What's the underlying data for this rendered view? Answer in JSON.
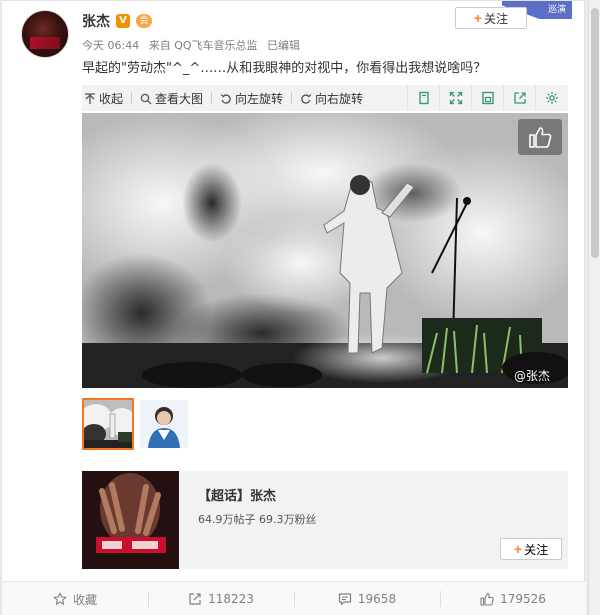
{
  "corner_tag": "巡演",
  "user": {
    "name": "张杰",
    "verified_badge": "V",
    "vip_badge": "会"
  },
  "follow_label": "关注",
  "meta": {
    "time": "今天 06:44",
    "source": "来自 QQ飞车音乐总监",
    "edited": "已编辑"
  },
  "post_text": "早起的\"劳动杰\"^_^……从和我眼神的对视中，你看得出我想说啥吗？",
  "media_toolbar": {
    "collapse": "收起",
    "view_large": "查看大图",
    "rotate_left": "向左旋转",
    "rotate_right": "向右旋转"
  },
  "photo": {
    "watermark": "@张杰"
  },
  "topic_card": {
    "title": "【超话】张杰",
    "stats": "64.9万帖子 69.3万粉丝",
    "follow_label": "关注"
  },
  "actions": {
    "favorite": "收藏",
    "repost": "118223",
    "comment": "19658",
    "like": "179526"
  },
  "colors": {
    "accent_orange": "#ff8140",
    "selected_thumb_border": "#f47720",
    "toolbar_icon_green": "#3a9a6e",
    "panel_bg": "#f2f2f5"
  }
}
